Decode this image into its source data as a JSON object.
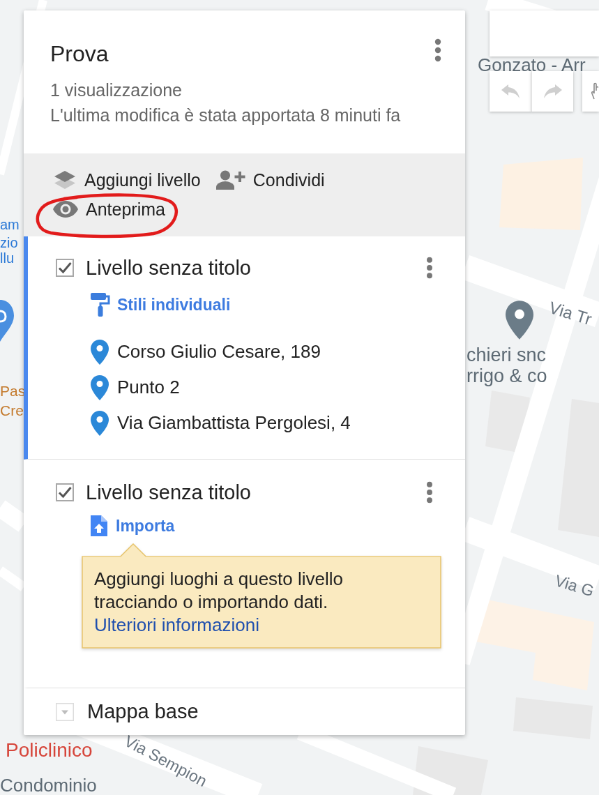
{
  "map": {
    "labels": [
      {
        "text": "Gonzato - Arr",
        "kind": "place"
      },
      {
        "text": "am",
        "kind": "poi"
      },
      {
        "text": "zio",
        "kind": "poi"
      },
      {
        "text": "llu",
        "kind": "poi"
      },
      {
        "text": "Via Tr",
        "kind": "street"
      },
      {
        "text": "chieri snc",
        "kind": "place"
      },
      {
        "text": "rrigo & co",
        "kind": "place"
      },
      {
        "text": "Pas",
        "kind": "food"
      },
      {
        "text": "Cre",
        "kind": "food"
      },
      {
        "text": "Via G",
        "kind": "street"
      },
      {
        "text": "Via Sempion",
        "kind": "street"
      },
      {
        "text": "Policlinico",
        "kind": "health"
      },
      {
        "text": "Condominio",
        "kind": "place"
      }
    ],
    "history": [
      {
        "kind": "undo",
        "disabled": true
      },
      {
        "kind": "redo",
        "disabled": true
      }
    ]
  },
  "panel": {
    "title": "Prova",
    "views": "1 visualizzazione",
    "last_edit": "L'ultima modifica è stata apportata 8 minuti fa",
    "actions": [
      {
        "kind": "add_layer",
        "label": "Aggiungi livello",
        "circled": false
      },
      {
        "kind": "share",
        "label": "Condividi",
        "circled": false
      },
      {
        "kind": "preview",
        "label": "Anteprima",
        "circled": true
      }
    ],
    "layers": [
      {
        "title": "Livello senza titolo",
        "checked": true,
        "selected": true,
        "link": {
          "kind": "style",
          "label": "Stili individuali"
        },
        "places": [
          "Corso Giulio Cesare, 189",
          "Punto 2",
          "Via Giambattista Pergolesi, 4"
        ]
      },
      {
        "title": "Livello senza titolo",
        "checked": true,
        "selected": false,
        "link": {
          "kind": "import",
          "label": "Importa"
        },
        "tip": {
          "text": "Aggiungi luoghi a questo livello tracciando o importando dati.",
          "link": "Ulteriori informazioni"
        }
      }
    ],
    "base_map": {
      "label": "Mappa base",
      "expanded": false
    }
  }
}
